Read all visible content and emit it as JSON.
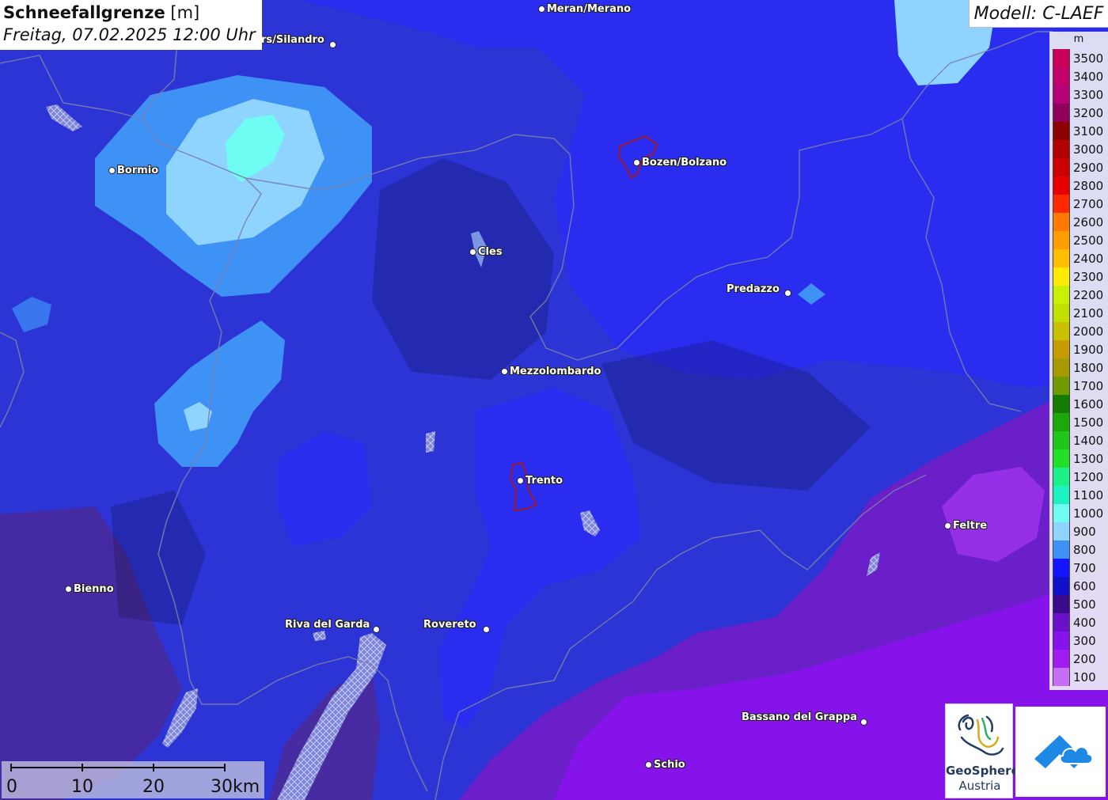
{
  "title": {
    "main": "Schneefallgrenze",
    "unit": "[m]",
    "date": "Freitag, 07.02.2025 12:00 Uhr"
  },
  "model": "Modell: C-LAEF",
  "legend": {
    "unit": "m",
    "entries": [
      {
        "label": "3500",
        "color": "#c8005a"
      },
      {
        "label": "3400",
        "color": "#c1006a"
      },
      {
        "label": "3300",
        "color": "#b50077"
      },
      {
        "label": "3200",
        "color": "#8e005a"
      },
      {
        "label": "3100",
        "color": "#8c0000"
      },
      {
        "label": "3000",
        "color": "#b30000"
      },
      {
        "label": "2900",
        "color": "#cc0000"
      },
      {
        "label": "2800",
        "color": "#e60000"
      },
      {
        "label": "2700",
        "color": "#ff2a00"
      },
      {
        "label": "2600",
        "color": "#ff7a00"
      },
      {
        "label": "2500",
        "color": "#ff9e00"
      },
      {
        "label": "2400",
        "color": "#ffbf00"
      },
      {
        "label": "2300",
        "color": "#ffea00"
      },
      {
        "label": "2200",
        "color": "#c8f000"
      },
      {
        "label": "2100",
        "color": "#c2df00"
      },
      {
        "label": "2000",
        "color": "#c8c000"
      },
      {
        "label": "1900",
        "color": "#c79c00"
      },
      {
        "label": "1800",
        "color": "#a69a00"
      },
      {
        "label": "1700",
        "color": "#6f9a00"
      },
      {
        "label": "1600",
        "color": "#157a00"
      },
      {
        "label": "1500",
        "color": "#1ca80a"
      },
      {
        "label": "1400",
        "color": "#22c51c"
      },
      {
        "label": "1300",
        "color": "#22e028"
      },
      {
        "label": "1200",
        "color": "#1bf08a"
      },
      {
        "label": "1100",
        "color": "#1cf2c2"
      },
      {
        "label": "1000",
        "color": "#6ffcf2"
      },
      {
        "label": "900",
        "color": "#8fd3ff"
      },
      {
        "label": "800",
        "color": "#3f92f5"
      },
      {
        "label": "700",
        "color": "#1414ff"
      },
      {
        "label": "600",
        "color": "#1010c8"
      },
      {
        "label": "500",
        "color": "#3a0a8a"
      },
      {
        "label": "400",
        "color": "#6c10c9"
      },
      {
        "label": "300",
        "color": "#8612ee"
      },
      {
        "label": "200",
        "color": "#a11cf0"
      },
      {
        "label": "100",
        "color": "#c66ef5"
      }
    ]
  },
  "places": [
    {
      "name": "Meran/Merano"
    },
    {
      "name": "rs/Silandro"
    },
    {
      "name": "Bormio"
    },
    {
      "name": "Bozen/Bolzano"
    },
    {
      "name": "Cles"
    },
    {
      "name": "Predazzo"
    },
    {
      "name": "Mezzolombardo"
    },
    {
      "name": "Trento"
    },
    {
      "name": "Feltre"
    },
    {
      "name": "Bienno"
    },
    {
      "name": "Riva del Garda"
    },
    {
      "name": "Rovereto"
    },
    {
      "name": "Bassano del Grappa"
    },
    {
      "name": "Schio"
    }
  ],
  "scale": {
    "labels": [
      "0",
      "10",
      "20",
      "30km"
    ]
  },
  "logos": {
    "geosphere_name": "GeoSphere",
    "geosphere_sub": "Austria"
  }
}
